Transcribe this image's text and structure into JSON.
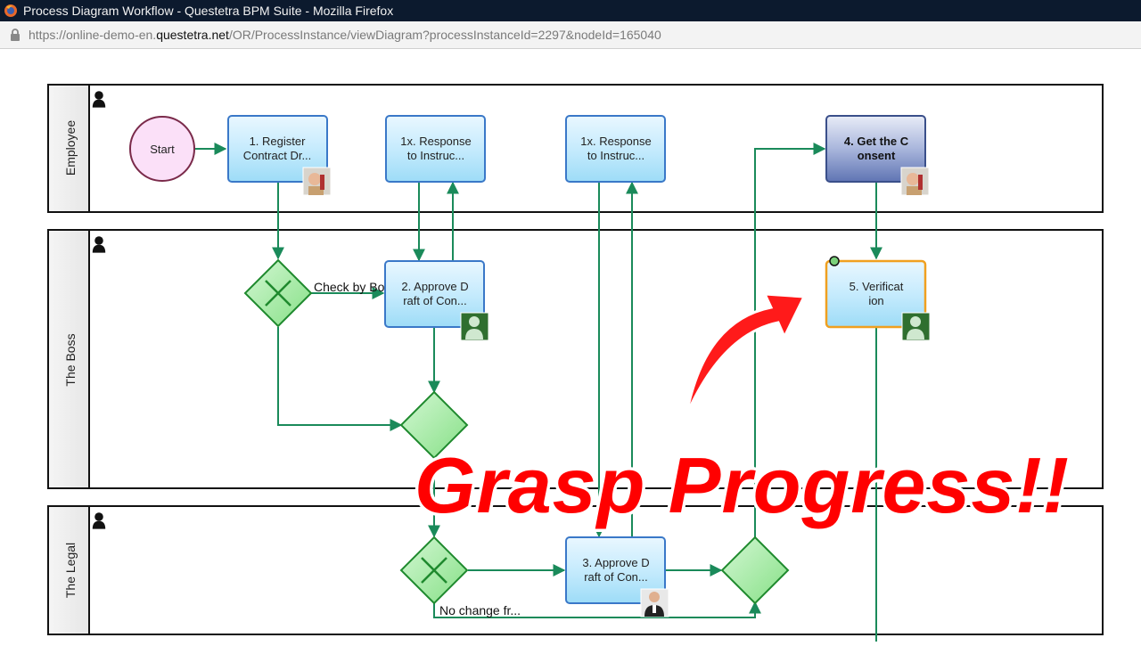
{
  "window": {
    "title": "Process Diagram Workflow - Questetra BPM Suite - Mozilla Firefox",
    "browser_icon": "firefox-icon"
  },
  "address_bar": {
    "lock_icon": "lock-icon",
    "url_prefix": "https://online-demo-en.",
    "url_domain": "questetra.net",
    "url_suffix": "/OR/ProcessInstance/viewDiagram?processInstanceId=2297&nodeId=165040"
  },
  "lanes": [
    {
      "label": "Employee"
    },
    {
      "label": "The Boss"
    },
    {
      "label": "The Legal"
    }
  ],
  "start_event": {
    "label": "Start"
  },
  "tasks": {
    "register": {
      "line1": "1. Register",
      "line2": "Contract Dr..."
    },
    "response_a": {
      "line1": "1x. Response",
      "line2": "to Instruc..."
    },
    "response_b": {
      "line1": "1x. Response",
      "line2": "to Instruc..."
    },
    "consent": {
      "line1": "4. Get the C",
      "line2": "onsent"
    },
    "approve_boss": {
      "line1": "2. Approve D",
      "line2": "raft of Con..."
    },
    "verification": {
      "line1": "5. Verificat",
      "line2": "ion"
    },
    "approve_legal": {
      "line1": "3. Approve D",
      "line2": "raft of Con..."
    }
  },
  "edge_labels": {
    "check_by_boss": "Check by Bo",
    "no_change": "No change fr..."
  },
  "banner": {
    "text": "Grasp Progress!!"
  },
  "colors": {
    "task_fill": "#aee3fb",
    "task_border": "#3a78c8",
    "active_task_fill": "#7b8fc4",
    "gateway_fill": "#a4eba4",
    "gateway_border": "#1f8a2e",
    "flow_line": "#1a8a5a",
    "start_fill": "#fbe0f8",
    "start_border": "#7a2a4a",
    "highlight_border": "#f0a020",
    "banner_text": "#ff0000"
  }
}
